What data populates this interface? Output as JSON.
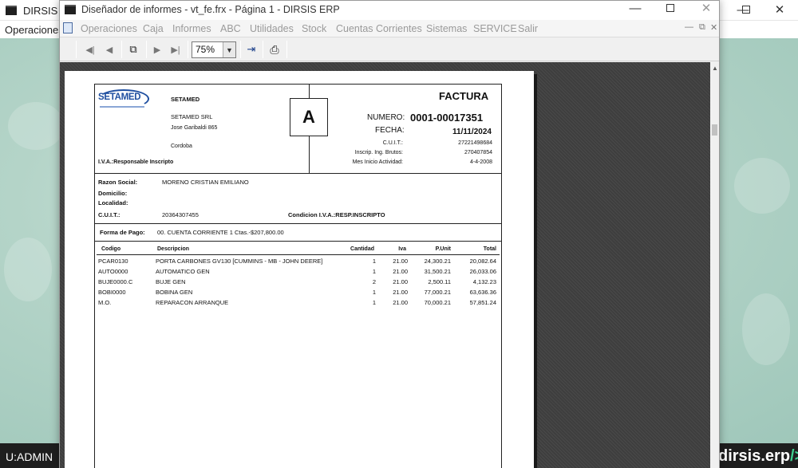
{
  "background_window": {
    "title": "DIRSIS ERP",
    "menu_first": "Operaciones",
    "user": "U:ADMIN",
    "brand": "dirsis.erp/>"
  },
  "window": {
    "title": "Diseñador de informes - vt_fe.frx - Página 1 - DIRSIS ERP",
    "menu": [
      "Operaciones",
      "Caja",
      "Informes",
      "ABC",
      "Utilidades",
      "Stock",
      "Cuentas Corrientes",
      "Sistemas",
      "SERVICE",
      "Salir"
    ],
    "zoom": "75%"
  },
  "invoice": {
    "company_logo": "SETAMED",
    "company_name": "SETAMED",
    "company_legal": "SETAMED SRL",
    "address": "Jose Garibaldi 865",
    "city": "Cordoba",
    "iva_condition": "I.V.A.:Responsable Inscripto",
    "letter": "A",
    "doc_type": "FACTURA",
    "numero_label": "NUMERO:",
    "numero": "0001-00017351",
    "fecha_label": "FECHA:",
    "fecha": "11/11/2024",
    "cuit_label": "C.U.I.T.:",
    "cuit": "27221498684",
    "iibb_label": "Inscrip. Ing. Brutos:",
    "iibb": "270407854",
    "inicio_label": "Mes Inicio Actividad:",
    "inicio": "4-4-2008",
    "client": {
      "razon_label": "Razon Social:",
      "razon": "MORENO CRISTIAN EMILIANO",
      "domicilio_label": "Domicilio:",
      "localidad_label": "Localidad:",
      "cuit_label": "C.U.I.T.:",
      "cuit": "20364307455",
      "cond_iva": "Condicion I.V.A.:RESP.INSCRIPTO"
    },
    "forma_pago_label": "Forma de Pago:",
    "forma_pago": "00. CUENTA CORRIENTE  1 Ctas.-$207,800.00",
    "table_headers": [
      "Codigo",
      "Descripcion",
      "Cantidad",
      "Iva",
      "P.Unit",
      "Total"
    ],
    "rows": [
      [
        "PCAR0130",
        "PORTA CARBONES GV130 [CUMMINS - MB - JOHN DEERE]",
        "1",
        "21.00",
        "24,300.21",
        "20,082.64"
      ],
      [
        "AUTO0000",
        "AUTOMATICO GEN",
        "1",
        "21.00",
        "31,500.21",
        "26,033.06"
      ],
      [
        "BUJE0000.C",
        "BUJE GEN",
        "2",
        "21.00",
        "2,500.11",
        "4,132.23"
      ],
      [
        "BOBI0000",
        "BOBINA GEN",
        "1",
        "21.00",
        "77,000.21",
        "63,636.36"
      ],
      [
        "M.O.",
        "REPARACON ARRANQUE",
        "1",
        "21.00",
        "70,000.21",
        "57,851.24"
      ]
    ]
  }
}
